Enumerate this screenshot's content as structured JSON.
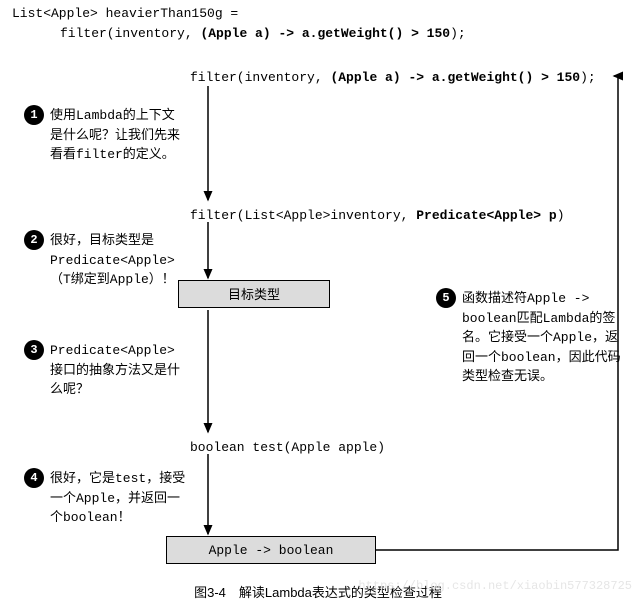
{
  "header": {
    "line1_plain": "List<Apple> heavierThan150g =",
    "line2_prefix": "filter(inventory, ",
    "line2_bold": "(Apple a) -> a.getWeight() > 150",
    "line2_suffix": ");"
  },
  "flow": {
    "top_prefix": "filter(inventory, ",
    "top_bold": "(Apple a) -> a.getWeight() > 150",
    "top_suffix": ");",
    "mid_prefix": "filter(List<Apple>inventory, ",
    "mid_bold": "Predicate<Apple> p",
    "mid_suffix": ")",
    "target_box": "目标类型",
    "test_sig": "boolean test(Apple apple)",
    "bottom_box": "Apple -> boolean"
  },
  "annotations": {
    "b1": "1",
    "a1": "使用Lambda的上下文是什么呢？让我们先来看看filter的定义。",
    "b2": "2",
    "a2_l1": "很好，目标类型是",
    "a2_l2": "Predicate<Apple>",
    "a2_l3": "（T绑定到Apple）！",
    "b3": "3",
    "a3_l1": "Predicate<Apple>",
    "a3_l2": "接口的抽象方法又是什么呢？",
    "b4": "4",
    "a4": "很好，它是test，接受一个Apple，并返回一个boolean！",
    "b5": "5",
    "a5": "函数描述符Apple -> boolean匹配Lambda的签名。它接受一个Apple，返回一个boolean，因此代码类型检查无误。"
  },
  "caption": "图3-4　解读Lambda表达式的类型检查过程",
  "watermark": "https://blog.csdn.net/xiaobin577328725"
}
